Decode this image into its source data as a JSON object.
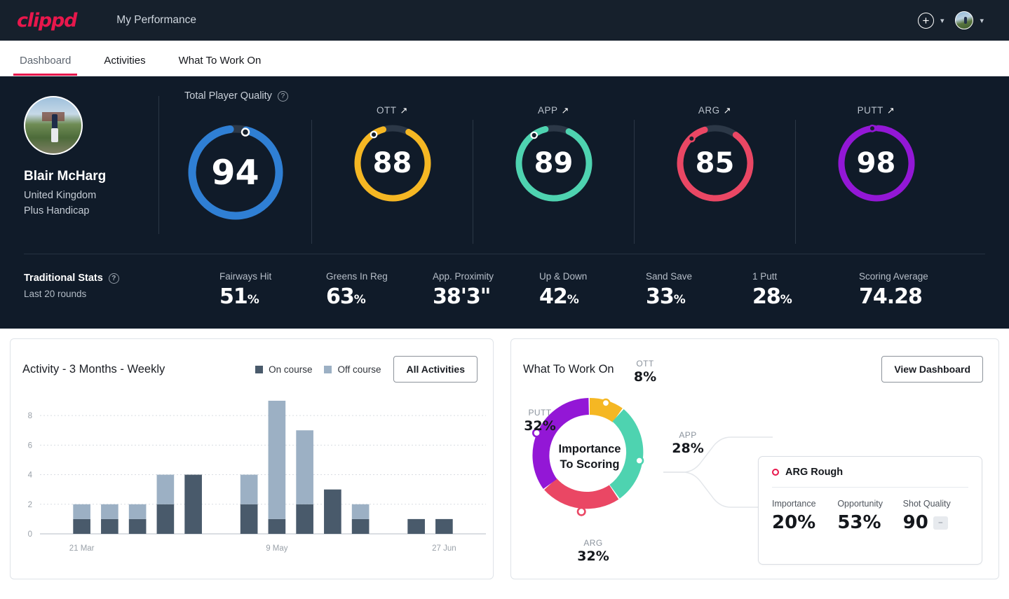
{
  "topbar": {
    "logo": "clippd",
    "title": "My Performance",
    "add_icon": "plus-circle-icon",
    "chevron": "⌄"
  },
  "nav": {
    "tabs": [
      {
        "label": "Dashboard",
        "active": true
      },
      {
        "label": "Activities",
        "active": false
      },
      {
        "label": "What To Work On",
        "active": false
      }
    ]
  },
  "player": {
    "name": "Blair McHarg",
    "country": "United Kingdom",
    "handicap": "Plus Handicap"
  },
  "quality": {
    "section_label": "Total Player Quality",
    "help": "?",
    "gauges": [
      {
        "label": "",
        "value": "94",
        "color": "#2f7fd4",
        "pct": 94,
        "arrow": ""
      },
      {
        "label": "OTT",
        "value": "88",
        "color": "#f5b723",
        "pct": 88,
        "arrow": "↗"
      },
      {
        "label": "APP",
        "value": "89",
        "color": "#4ed3b0",
        "pct": 89,
        "arrow": "↗"
      },
      {
        "label": "ARG",
        "value": "85",
        "color": "#ea4764",
        "pct": 85,
        "arrow": "↗"
      },
      {
        "label": "PUTT",
        "value": "98",
        "color": "#9317d6",
        "pct": 98,
        "arrow": "↗"
      }
    ]
  },
  "traditional": {
    "title": "Traditional Stats",
    "help": "?",
    "subtitle": "Last 20 rounds",
    "stats": [
      {
        "label": "Fairways Hit",
        "value": "51",
        "unit": "%"
      },
      {
        "label": "Greens In Reg",
        "value": "63",
        "unit": "%"
      },
      {
        "label": "App. Proximity",
        "value": "38'3\"",
        "unit": ""
      },
      {
        "label": "Up & Down",
        "value": "42",
        "unit": "%"
      },
      {
        "label": "Sand Save",
        "value": "33",
        "unit": "%"
      },
      {
        "label": "1 Putt",
        "value": "28",
        "unit": "%"
      },
      {
        "label": "Scoring Average",
        "value": "74.28",
        "unit": ""
      }
    ]
  },
  "activity": {
    "title": "Activity - 3 Months - Weekly",
    "legend": [
      {
        "label": "On course",
        "color": "#495a6b"
      },
      {
        "label": "Off course",
        "color": "#9cb0c4"
      }
    ],
    "button": "All Activities"
  },
  "chart_data": {
    "type": "bar",
    "title": "Activity - 3 Months - Weekly",
    "stacked": true,
    "xlabel": "",
    "ylabel": "",
    "ylim": [
      0,
      9
    ],
    "yticks": [
      0,
      2,
      4,
      6,
      8
    ],
    "grid": true,
    "legend_position": "top-right",
    "tick_labels": [
      "21 Mar",
      "9 May",
      "27 Jun"
    ],
    "tick_indices": [
      1,
      8,
      14
    ],
    "categories": [
      "w1",
      "w2",
      "w3",
      "w4",
      "w5",
      "w6",
      "w7",
      "w8",
      "w9",
      "w10",
      "w11",
      "w12",
      "w13",
      "w14",
      "w15",
      "w16"
    ],
    "series": [
      {
        "name": "On course",
        "color": "#495a6b",
        "values": [
          0,
          1,
          1,
          1,
          2,
          4,
          0,
          2,
          1,
          2,
          3,
          1,
          0,
          1,
          1,
          0
        ]
      },
      {
        "name": "Off course",
        "color": "#9cb0c4",
        "values": [
          0,
          1,
          1,
          1,
          2,
          0,
          0,
          2,
          8,
          5,
          0,
          1,
          0,
          0,
          0,
          0
        ]
      }
    ],
    "totals": [
      0,
      2,
      2,
      2,
      4,
      4,
      0,
      4,
      9,
      7,
      3,
      2,
      0,
      1,
      1,
      0
    ]
  },
  "wtwo": {
    "title": "What To Work On",
    "button": "View Dashboard",
    "center_line1": "Importance",
    "center_line2": "To Scoring",
    "donut": {
      "type": "pie",
      "title": "Importance To Scoring",
      "slices": [
        {
          "name": "OTT",
          "value": 8,
          "color": "#f5b723"
        },
        {
          "name": "APP",
          "value": 28,
          "color": "#4ed3b0"
        },
        {
          "name": "ARG",
          "value": 32,
          "color": "#ea4764"
        },
        {
          "name": "PUTT",
          "value": 32,
          "color": "#9317d6"
        }
      ],
      "labels": [
        {
          "name": "OTT",
          "value": "8%"
        },
        {
          "name": "APP",
          "value": "28%"
        },
        {
          "name": "ARG",
          "value": "32%"
        },
        {
          "name": "PUTT",
          "value": "32%"
        }
      ]
    },
    "detail": {
      "title": "ARG Rough",
      "marker_color": "#e8174c",
      "metrics": [
        {
          "label": "Importance",
          "value": "20%"
        },
        {
          "label": "Opportunity",
          "value": "53%"
        },
        {
          "label": "Shot Quality",
          "value": "90",
          "badge": "–"
        }
      ]
    }
  }
}
